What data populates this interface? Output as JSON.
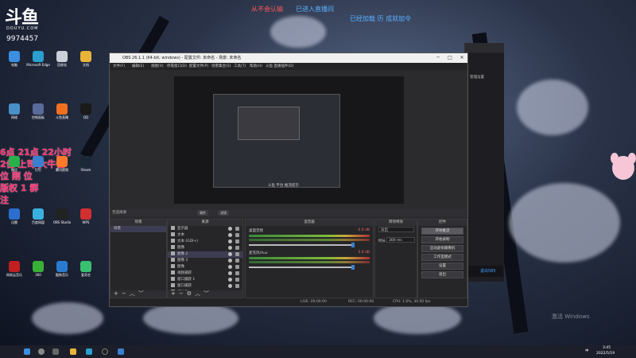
{
  "stream_overlay": {
    "brand_sub": "DOUYU.COM",
    "room_id": "9974457",
    "top_messages": [
      {
        "text": "从不会认输",
        "color": "#ff5a5a"
      },
      {
        "text": "已进入直播间",
        "color": "#5ab0ff"
      },
      {
        "text": "已经加载 历 成就加令",
        "color": "#5ab0ff"
      }
    ],
    "red_overlay_lines": [
      "6点 21点 22小时",
      "2位 上司 大牛位",
      "位 刚 位",
      "版权 1 群",
      "注"
    ]
  },
  "obs_window": {
    "title": "OBS 26.1.1 (64-bit, windows) - 配置文件: 未命名 - 场景: 未命名",
    "window_controls": {
      "minimize": "─",
      "maximize": "□",
      "close": "✕"
    },
    "menu": [
      "文件(F)",
      "编辑(E)",
      "视图(V)",
      "停靠窗口(D)",
      "配置文件(P)",
      "场景集合(S)",
      "工具(T)",
      "帮助(H)",
      "斗鱼 直播插件(D)"
    ],
    "preview_tip": "斗鱼 平台 推流提示",
    "status_strip": {
      "label": "无选择源",
      "properties": "属性",
      "filters": "滤镜"
    },
    "docks": {
      "scenes": {
        "header": "场景",
        "items": [
          "场景"
        ]
      },
      "sources": {
        "header": "来源",
        "items": [
          "显示器",
          "文本",
          "文本 (GDI+)",
          "图像",
          "图像 2",
          "图像 3",
          "图像",
          "视频捕获",
          "窗口捕获 1",
          "窗口捕获",
          "媒体源"
        ]
      },
      "mixer": {
        "header": "混音器",
        "channels": [
          {
            "name": "桌面音频",
            "db": "0.0 dB"
          },
          {
            "name": "麦克风/Aux",
            "db": "0.0 dB"
          }
        ]
      },
      "transitions": {
        "header": "转场特效",
        "type": "淡出",
        "duration_label": "时长",
        "duration_value": "300 ms"
      },
      "controls": {
        "header": "控件",
        "buttons": [
          "开始推流",
          "开始录制",
          "启动虚拟摄像机",
          "工作室模式",
          "设置",
          "退出"
        ]
      }
    },
    "status_bar": {
      "live": "LIVE: 00:00:00",
      "rec": "REC: 00:00:00",
      "cpu": "CPU: 1.6%, 30.00 fps"
    }
  },
  "back_window": {
    "label": "管理设置",
    "bottom_link": "退出585"
  },
  "desktop_icons": [
    "电脑",
    "Microsoft Edge",
    "回收站",
    "文档",
    "网络",
    "控制面板",
    "斗鱼直播",
    "QQ",
    "微信",
    "钉钉",
    "腾讯视频",
    "Steam",
    "迅雷",
    "百度网盘",
    "OBS Studio",
    "WPS",
    "网易云音乐",
    "360",
    "酷狗音乐",
    "爱奇艺"
  ],
  "taskbar": {
    "tray_lang": "中",
    "time": "3:45",
    "date": "2022/5/19"
  },
  "watermark": "激活 Windows",
  "colors": {
    "obs_panel": "#2b2b2e",
    "accent_blue": "#3a7fd0",
    "overlay_red": "#ff2d6e"
  }
}
